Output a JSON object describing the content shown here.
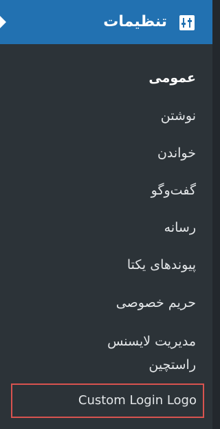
{
  "header": {
    "title": "تنظیمات",
    "icon": "settings-sliders-icon",
    "accent_color": "#2271b1"
  },
  "submenu": {
    "items": [
      {
        "label": "عمومی",
        "current": true
      },
      {
        "label": "نوشتن"
      },
      {
        "label": "خواندن"
      },
      {
        "label": "گفت‌وگو"
      },
      {
        "label": "رسانه"
      },
      {
        "label": "پیوندهای یکتا"
      },
      {
        "label": "حریم خصوصی"
      },
      {
        "label": "مدیریت لایسنس راستچین"
      },
      {
        "label": "Custom Login Logo"
      }
    ],
    "highlight_color": "#d9534f"
  }
}
